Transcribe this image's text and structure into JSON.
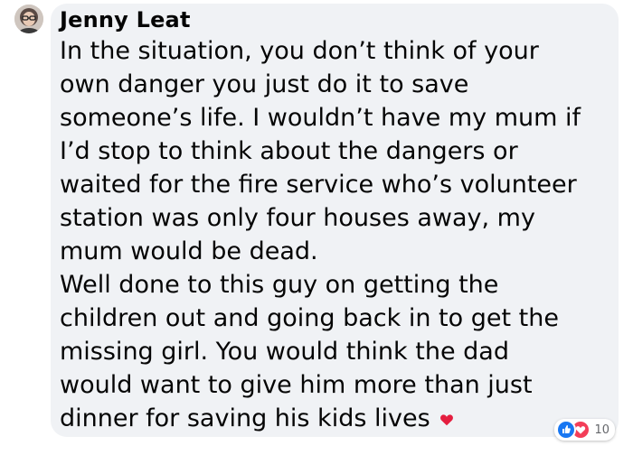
{
  "comment": {
    "author": "Jenny Leat",
    "text": "In the situation, you don’t think of your\nown danger you just do it to save\nsomeone’s life. I wouldn’t have my mum if\nI’d stop to think about the dangers or\nwaited for the fire service who’s volunteer\nstation was only four houses away, my\nmum would be dead.\nWell done to this guy on getting the\nchildren out and going back in to get the\nmissing girl. You would think the dad\nwould want to give him more than just\ndinner for saving his kids lives ",
    "trailing_emoji": "heart-emoji",
    "reactions": {
      "icons": [
        "like-icon",
        "love-icon"
      ],
      "count": "10"
    }
  },
  "colors": {
    "bubble_background": "#f0f2f5",
    "text": "#050505",
    "like_blue": "#1877f2",
    "love_red": "#f33e58",
    "count_gray": "#65676b"
  }
}
